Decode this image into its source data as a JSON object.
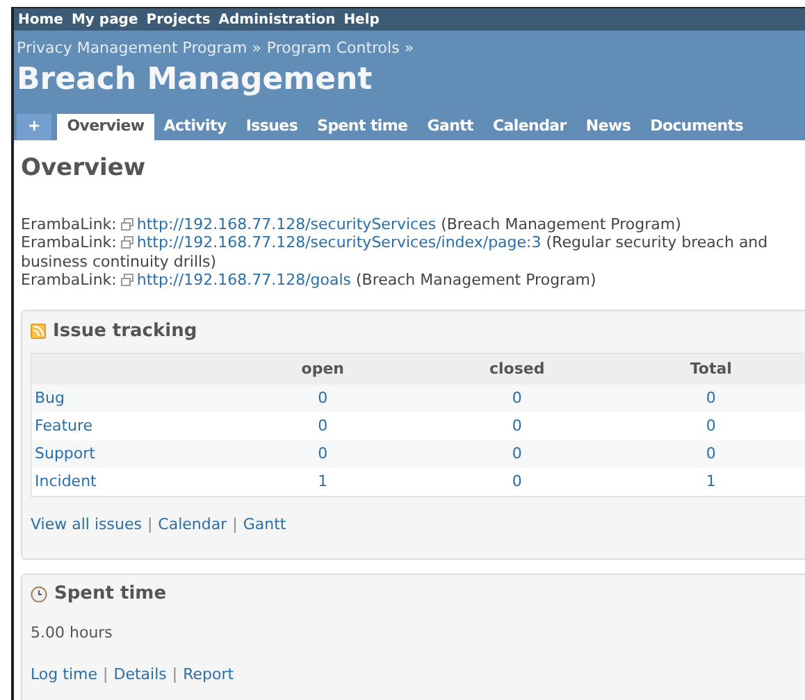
{
  "top_menu": [
    "Home",
    "My page",
    "Projects",
    "Administration",
    "Help"
  ],
  "breadcrumb": [
    "Privacy Management Program »",
    "Program Controls »"
  ],
  "project_title": "Breach Management",
  "tabs": [
    {
      "label": "+",
      "kind": "new",
      "selected": false
    },
    {
      "label": "Overview",
      "kind": "tab",
      "selected": true
    },
    {
      "label": "Activity",
      "kind": "tab",
      "selected": false
    },
    {
      "label": "Issues",
      "kind": "tab",
      "selected": false
    },
    {
      "label": "Spent time",
      "kind": "tab",
      "selected": false
    },
    {
      "label": "Gantt",
      "kind": "tab",
      "selected": false
    },
    {
      "label": "Calendar",
      "kind": "tab",
      "selected": false
    },
    {
      "label": "News",
      "kind": "tab",
      "selected": false
    },
    {
      "label": "Documents",
      "kind": "tab",
      "selected": false
    }
  ],
  "page_title": "Overview",
  "links": [
    {
      "prefix": "ErambaLink:",
      "url": "http://192.168.77.128/securityServices",
      "note": "(Breach Management Program)"
    },
    {
      "prefix": "ErambaLink:",
      "url": "http://192.168.77.128/securityServices/index/page:3",
      "note": "(Regular security breach and business continuity drills)"
    },
    {
      "prefix": "ErambaLink:",
      "url": "http://192.168.77.128/goals",
      "note": "(Breach Management Program)"
    }
  ],
  "issue_tracking": {
    "title": "Issue tracking",
    "columns": [
      "open",
      "closed",
      "Total"
    ],
    "rows": [
      {
        "tracker": "Bug",
        "open": "0",
        "closed": "0",
        "total": "0"
      },
      {
        "tracker": "Feature",
        "open": "0",
        "closed": "0",
        "total": "0"
      },
      {
        "tracker": "Support",
        "open": "0",
        "closed": "0",
        "total": "0"
      },
      {
        "tracker": "Incident",
        "open": "1",
        "closed": "0",
        "total": "1"
      }
    ],
    "links": [
      "View all issues",
      "Calendar",
      "Gantt"
    ],
    "separators": [
      "|",
      "|"
    ]
  },
  "spent_time": {
    "title": "Spent time",
    "total": "5.00 hours",
    "links": [
      "Log time",
      "Details",
      "Report"
    ],
    "separators": [
      "|",
      "|"
    ]
  }
}
